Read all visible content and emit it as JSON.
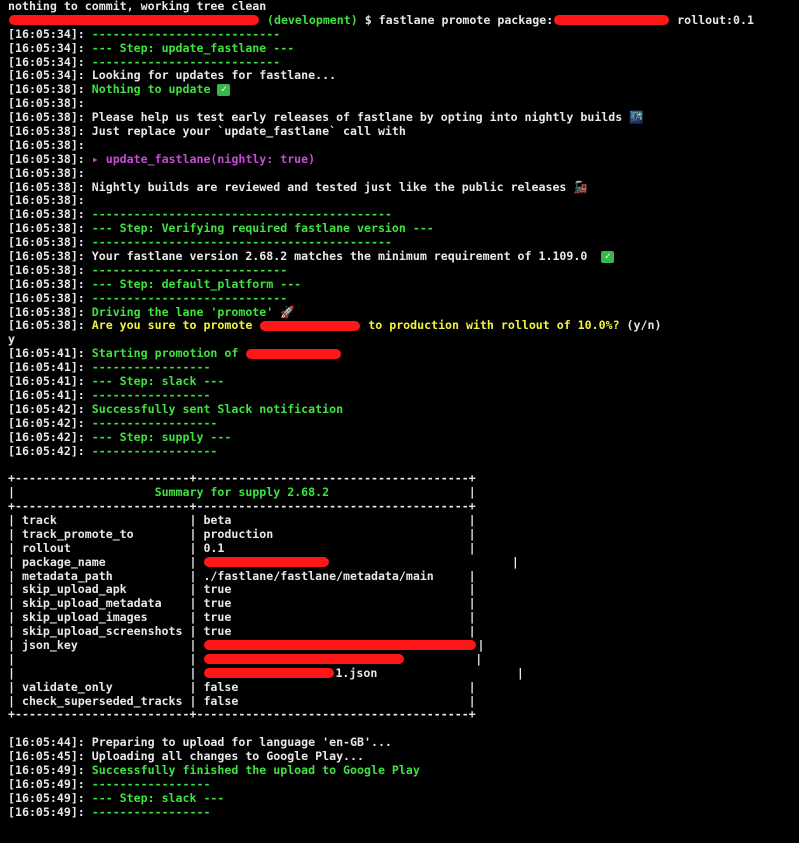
{
  "terminal": {
    "lines": [
      {
        "segs": [
          {
            "t": "nothing to commit, working tree clean",
            "c": "white"
          }
        ]
      },
      {
        "segs": [
          {
            "redact": true,
            "w": 250
          },
          {
            "t": " (development)",
            "c": "green"
          },
          {
            "t": " $ fastlane promote package:",
            "c": "white"
          },
          {
            "redact": true,
            "w": 115
          },
          {
            "t": " rollout:0.1",
            "c": "white"
          }
        ]
      },
      {
        "segs": [
          {
            "t": "[16:05:34]: ",
            "c": "white"
          },
          {
            "t": "---------------------------",
            "c": "green"
          }
        ]
      },
      {
        "segs": [
          {
            "t": "[16:05:34]: ",
            "c": "white"
          },
          {
            "t": "--- Step: update_fastlane ---",
            "c": "green"
          }
        ]
      },
      {
        "segs": [
          {
            "t": "[16:05:34]: ",
            "c": "white"
          },
          {
            "t": "---------------------------",
            "c": "green"
          }
        ]
      },
      {
        "segs": [
          {
            "t": "[16:05:34]: ",
            "c": "white"
          },
          {
            "t": "Looking for updates for fastlane...",
            "c": "white"
          }
        ]
      },
      {
        "segs": [
          {
            "t": "[16:05:38]: ",
            "c": "white"
          },
          {
            "t": "Nothing to update ",
            "c": "green"
          },
          {
            "icon": "check"
          }
        ]
      },
      {
        "segs": [
          {
            "t": "[16:05:38]: ",
            "c": "white"
          }
        ]
      },
      {
        "segs": [
          {
            "t": "[16:05:38]: ",
            "c": "white"
          },
          {
            "t": "Please help us test early releases of fastlane by opting into nightly builds ",
            "c": "white"
          },
          {
            "emoji": "🌃"
          }
        ]
      },
      {
        "segs": [
          {
            "t": "[16:05:38]: ",
            "c": "white"
          },
          {
            "t": "Just replace your `update_fastlane` call with",
            "c": "white"
          }
        ]
      },
      {
        "segs": [
          {
            "t": "[16:05:38]: ",
            "c": "white"
          }
        ]
      },
      {
        "segs": [
          {
            "t": "[16:05:38]: ",
            "c": "white"
          },
          {
            "t": "▸ update_fastlane(nightly: true)",
            "c": "magenta"
          }
        ]
      },
      {
        "segs": [
          {
            "t": "[16:05:38]: ",
            "c": "white"
          }
        ]
      },
      {
        "segs": [
          {
            "t": "[16:05:38]: ",
            "c": "white"
          },
          {
            "t": "Nightly builds are reviewed and tested just like the public releases ",
            "c": "white"
          },
          {
            "emoji": "🚂"
          }
        ]
      },
      {
        "segs": [
          {
            "t": "[16:05:38]: ",
            "c": "white"
          }
        ]
      },
      {
        "segs": [
          {
            "t": "[16:05:38]: ",
            "c": "white"
          },
          {
            "t": "-------------------------------------------",
            "c": "green"
          }
        ]
      },
      {
        "segs": [
          {
            "t": "[16:05:38]: ",
            "c": "white"
          },
          {
            "t": "--- Step: Verifying required fastlane version ---",
            "c": "green"
          }
        ]
      },
      {
        "segs": [
          {
            "t": "[16:05:38]: ",
            "c": "white"
          },
          {
            "t": "-------------------------------------------",
            "c": "green"
          }
        ]
      },
      {
        "segs": [
          {
            "t": "[16:05:38]: ",
            "c": "white"
          },
          {
            "t": "Your fastlane version 2.68.2 matches the minimum requirement of 1.109.0  ",
            "c": "white"
          },
          {
            "icon": "check"
          }
        ]
      },
      {
        "segs": [
          {
            "t": "[16:05:38]: ",
            "c": "white"
          },
          {
            "t": "----------------------------",
            "c": "green"
          }
        ]
      },
      {
        "segs": [
          {
            "t": "[16:05:38]: ",
            "c": "white"
          },
          {
            "t": "--- Step: default_platform ---",
            "c": "green"
          }
        ]
      },
      {
        "segs": [
          {
            "t": "[16:05:38]: ",
            "c": "white"
          },
          {
            "t": "----------------------------",
            "c": "green"
          }
        ]
      },
      {
        "segs": [
          {
            "t": "[16:05:38]: ",
            "c": "white"
          },
          {
            "t": "Driving the lane 'promote' ",
            "c": "green"
          },
          {
            "emoji": "🚀"
          }
        ]
      },
      {
        "segs": [
          {
            "t": "[16:05:38]: ",
            "c": "white"
          },
          {
            "t": "Are you sure to promote ",
            "c": "yellow"
          },
          {
            "redact": true,
            "w": 100
          },
          {
            "t": " to production with rollout of 10.0%? ",
            "c": "yellow"
          },
          {
            "t": "(y/n)",
            "c": "white"
          }
        ]
      },
      {
        "segs": [
          {
            "t": "y",
            "c": "white"
          }
        ]
      },
      {
        "segs": [
          {
            "t": "[16:05:41]: ",
            "c": "white"
          },
          {
            "t": "Starting promotion of ",
            "c": "green"
          },
          {
            "redact": true,
            "w": 95
          }
        ]
      },
      {
        "segs": [
          {
            "t": "[16:05:41]: ",
            "c": "white"
          },
          {
            "t": "-----------------",
            "c": "green"
          }
        ]
      },
      {
        "segs": [
          {
            "t": "[16:05:41]: ",
            "c": "white"
          },
          {
            "t": "--- Step: slack ---",
            "c": "green"
          }
        ]
      },
      {
        "segs": [
          {
            "t": "[16:05:41]: ",
            "c": "white"
          },
          {
            "t": "-----------------",
            "c": "green"
          }
        ]
      },
      {
        "segs": [
          {
            "t": "[16:05:42]: ",
            "c": "white"
          },
          {
            "t": "Successfully sent Slack notification",
            "c": "green"
          }
        ]
      },
      {
        "segs": [
          {
            "t": "[16:05:42]: ",
            "c": "white"
          },
          {
            "t": "------------------",
            "c": "green"
          }
        ]
      },
      {
        "segs": [
          {
            "t": "[16:05:42]: ",
            "c": "white"
          },
          {
            "t": "--- Step: supply ---",
            "c": "green"
          }
        ]
      },
      {
        "segs": [
          {
            "t": "[16:05:42]: ",
            "c": "white"
          },
          {
            "t": "------------------",
            "c": "green"
          }
        ]
      },
      {
        "segs": []
      },
      {
        "segs": [
          {
            "t": "+-------------------------+---------------------------------------+",
            "c": "white"
          }
        ]
      },
      {
        "segs": [
          {
            "t": "|                    ",
            "c": "white"
          },
          {
            "t": "Summary for supply 2.68.2",
            "c": "green"
          },
          {
            "t": "                    |",
            "c": "white"
          }
        ]
      },
      {
        "segs": [
          {
            "t": "+-------------------------+---------------------------------------+",
            "c": "white"
          }
        ]
      },
      {
        "segs": [
          {
            "t": "| track                   | beta                                  |",
            "c": "white"
          }
        ]
      },
      {
        "segs": [
          {
            "t": "| track_promote_to        | production                            |",
            "c": "white"
          }
        ]
      },
      {
        "segs": [
          {
            "t": "| rollout                 | 0.1                                   |",
            "c": "white"
          }
        ]
      },
      {
        "segs": [
          {
            "t": "| package_name            | ",
            "c": "white"
          },
          {
            "redact": true,
            "w": 125
          },
          {
            "t": "                          |",
            "c": "white"
          }
        ]
      },
      {
        "segs": [
          {
            "t": "| metadata_path           | ./fastlane/fastlane/metadata/main     |",
            "c": "white"
          }
        ]
      },
      {
        "segs": [
          {
            "t": "| skip_upload_apk         | true                                  |",
            "c": "white"
          }
        ]
      },
      {
        "segs": [
          {
            "t": "| skip_upload_metadata    | true                                  |",
            "c": "white"
          }
        ]
      },
      {
        "segs": [
          {
            "t": "| skip_upload_images      | true                                  |",
            "c": "white"
          }
        ]
      },
      {
        "segs": [
          {
            "t": "| skip_upload_screenshots | true                                  |",
            "c": "white"
          }
        ]
      },
      {
        "segs": [
          {
            "t": "| json_key                | ",
            "c": "white"
          },
          {
            "redact": true,
            "w": 272
          },
          {
            "t": "|",
            "c": "white"
          }
        ]
      },
      {
        "segs": [
          {
            "t": "|                         | ",
            "c": "white"
          },
          {
            "redact": true,
            "w": 200
          },
          {
            "t": "          |",
            "c": "white"
          }
        ]
      },
      {
        "segs": [
          {
            "t": "|                         | ",
            "c": "white"
          },
          {
            "redact": true,
            "w": 130
          },
          {
            "t": "1.json                    |",
            "c": "white"
          }
        ]
      },
      {
        "segs": [
          {
            "t": "| validate_only           | false                                 |",
            "c": "white"
          }
        ]
      },
      {
        "segs": [
          {
            "t": "| check_superseded_tracks | false                                 |",
            "c": "white"
          }
        ]
      },
      {
        "segs": [
          {
            "t": "+-------------------------+---------------------------------------+",
            "c": "white"
          }
        ]
      },
      {
        "segs": []
      },
      {
        "segs": [
          {
            "t": "[16:05:44]: ",
            "c": "white"
          },
          {
            "t": "Preparing to upload for language 'en-GB'...",
            "c": "white"
          }
        ]
      },
      {
        "segs": [
          {
            "t": "[16:05:45]: ",
            "c": "white"
          },
          {
            "t": "Uploading all changes to Google Play...",
            "c": "white"
          }
        ]
      },
      {
        "segs": [
          {
            "t": "[16:05:49]: ",
            "c": "white"
          },
          {
            "t": "Successfully finished the upload to Google Play",
            "c": "green"
          }
        ]
      },
      {
        "segs": [
          {
            "t": "[16:05:49]: ",
            "c": "white"
          },
          {
            "t": "-----------------",
            "c": "green"
          }
        ]
      },
      {
        "segs": [
          {
            "t": "[16:05:49]: ",
            "c": "white"
          },
          {
            "t": "--- Step: slack ---",
            "c": "green"
          }
        ]
      },
      {
        "segs": [
          {
            "t": "[16:05:49]: ",
            "c": "white"
          },
          {
            "t": "-----------------",
            "c": "green"
          }
        ]
      }
    ]
  },
  "colors": {
    "background": "#000000",
    "text": "#e8e8e8",
    "green": "#3ee33e",
    "yellow": "#f2f245",
    "magenta": "#c94ad9",
    "redaction": "#ff1616"
  }
}
